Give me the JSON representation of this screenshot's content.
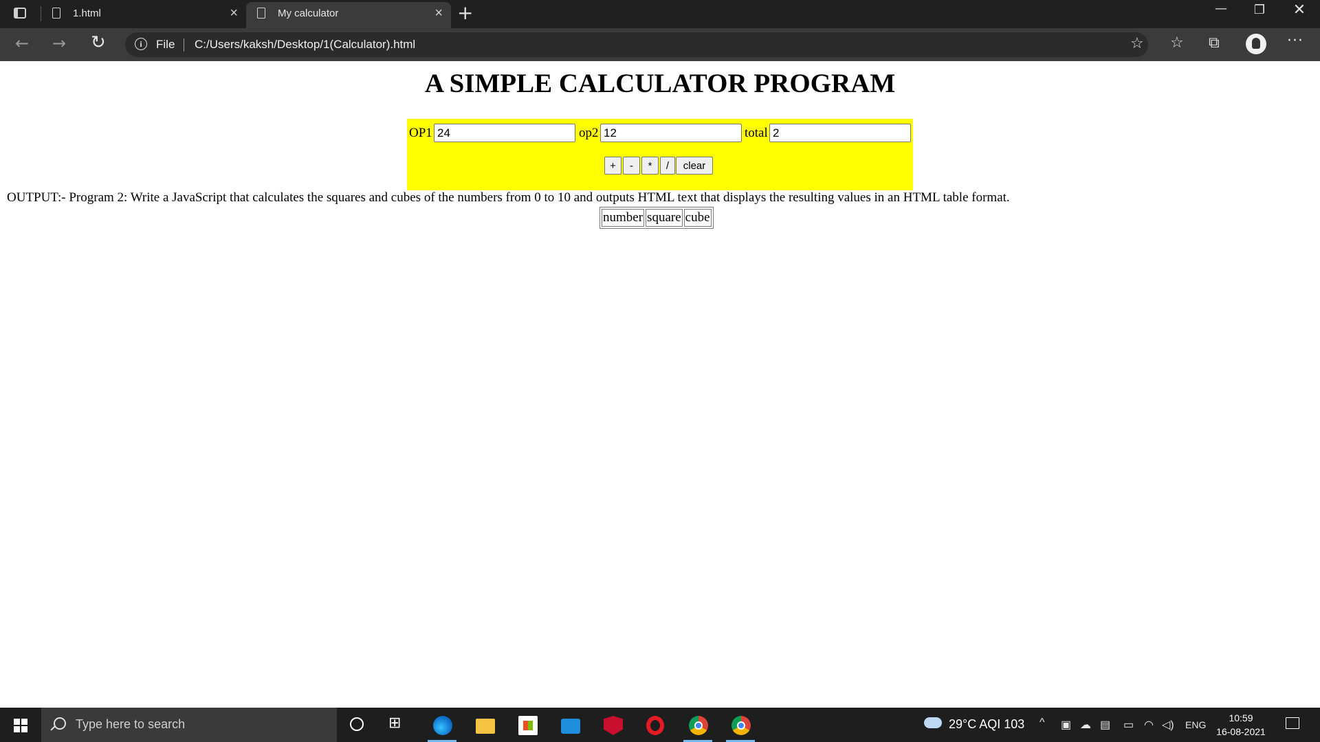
{
  "browser": {
    "tabs": [
      {
        "label": "1.html"
      },
      {
        "label": "My calculator"
      }
    ],
    "file_label": "File",
    "url": "C:/Users/kaksh/Desktop/1(Calculator).html"
  },
  "page": {
    "heading": "A SIMPLE CALCULATOR PROGRAM",
    "calculator": {
      "op1_label": "OP1",
      "op1_value": "24",
      "op2_label": "op2",
      "op2_value": "12",
      "total_label": "total",
      "total_value": "2",
      "buttons": {
        "add": "+",
        "sub": "-",
        "mul": "*",
        "div": "/",
        "clear": "clear"
      },
      "background_color": "#ffff00"
    },
    "output_text": "OUTPUT:- Program 2: Write a JavaScript that calculates the squares and cubes of the numbers from 0 to 10 and outputs HTML text that displays the resulting values in an HTML table format.",
    "table_headers": [
      "number",
      "square",
      "cube"
    ]
  },
  "taskbar": {
    "search_placeholder": "Type here to search",
    "weather": "29°C  AQI 103",
    "language": "ENG",
    "time": "10:59",
    "date": "16-08-2021"
  }
}
